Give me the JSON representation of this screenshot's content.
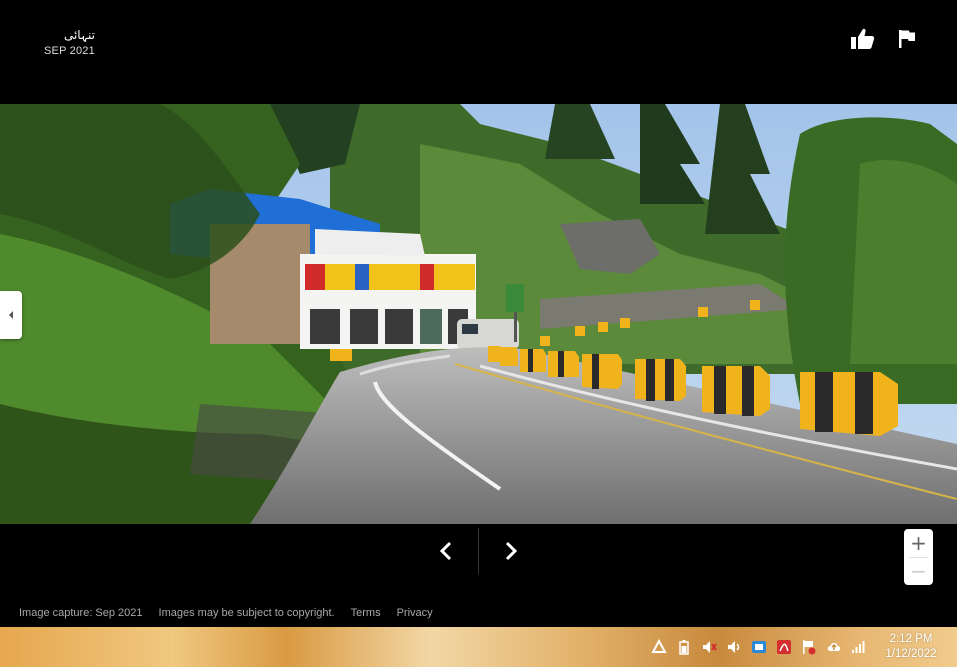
{
  "header": {
    "place_title": "تنہائی",
    "capture_date": "SEP 2021"
  },
  "actions": {
    "like_icon": "thumbs-up-icon",
    "report_icon": "flag-icon"
  },
  "photo": {
    "description_icon": "street-view-panorama"
  },
  "navigation": {
    "prev_icon": "chevron-left-icon",
    "next_icon": "chevron-right-icon"
  },
  "zoom": {
    "in_label": "+",
    "out_label": "−"
  },
  "footer": {
    "capture": "Image capture: Sep 2021",
    "copyright": "Images may be subject to copyright.",
    "terms": "Terms",
    "privacy": "Privacy"
  },
  "taskbar": {
    "tray_icons": [
      "drive-icon",
      "battery-icon",
      "mute-speaker-icon",
      "speaker-icon",
      "keyboard-icon",
      "acrobat-icon",
      "flag-alert-icon",
      "cloud-upload-icon",
      "signal-bars-icon"
    ],
    "time": "2:12 PM",
    "date": "1/12/2022"
  },
  "colors": {
    "viewer_bg": "#000000",
    "barrier_yellow": "#f1b31c",
    "sky": "#a9c7e9"
  }
}
